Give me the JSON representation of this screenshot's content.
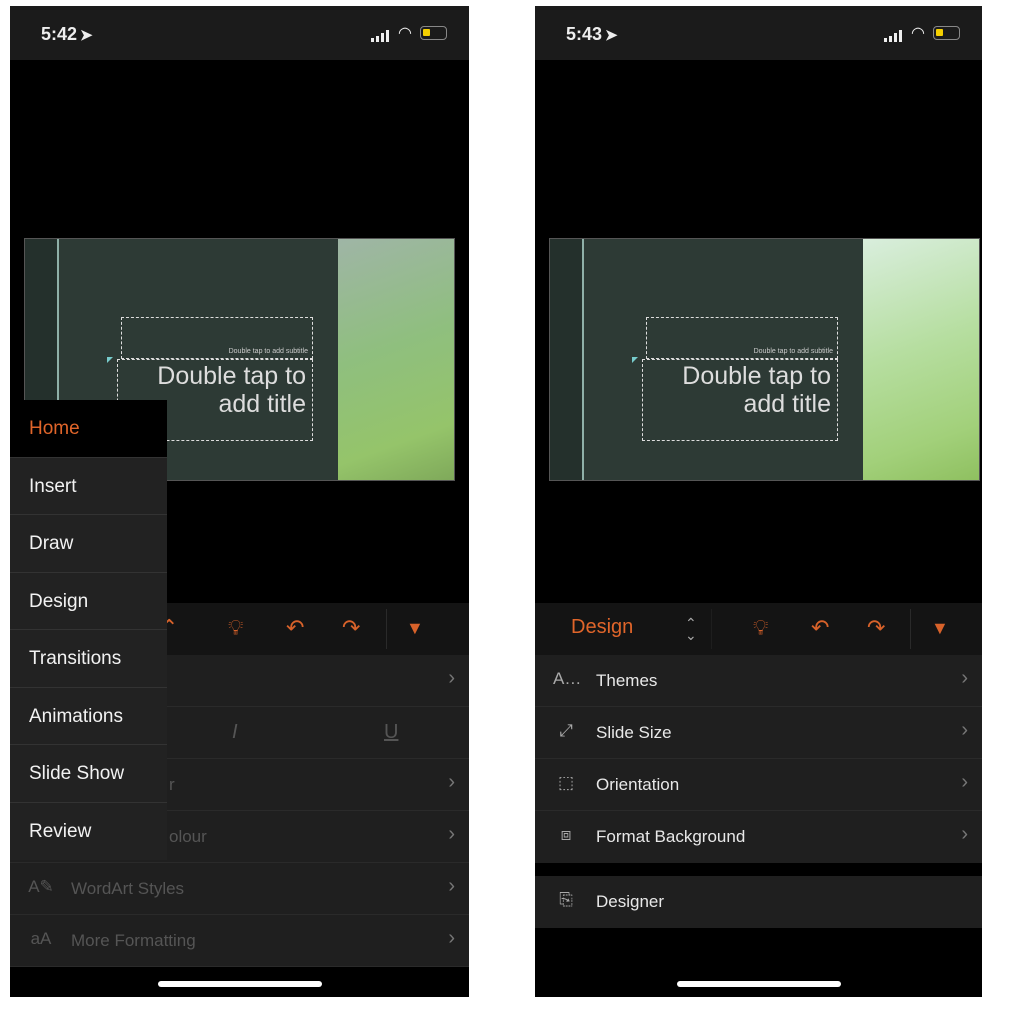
{
  "left": {
    "status": {
      "time": "5:42"
    },
    "slide": {
      "subtitle_placeholder": "Double tap to add subtitle",
      "title_placeholder": "Double tap to add title"
    },
    "tab_menu": {
      "items": [
        "Home",
        "Insert",
        "Draw",
        "Design",
        "Transitions",
        "Animations",
        "Slide Show",
        "Review"
      ],
      "active": "Home"
    },
    "list": {
      "partial_row_3": "r",
      "partial_row_4": "olour",
      "wordart": "WordArt Styles",
      "more_formatting": "More Formatting"
    },
    "format_row": {
      "italic": "I",
      "underline": "U"
    }
  },
  "right": {
    "status": {
      "time": "5:43"
    },
    "slide": {
      "subtitle_placeholder": "Double tap to add subtitle",
      "title_placeholder": "Double tap to add title"
    },
    "toolbar": {
      "tab": "Design"
    },
    "list": [
      {
        "label": "Themes",
        "icon": "themes-icon"
      },
      {
        "label": "Slide Size",
        "icon": "slide-size-icon"
      },
      {
        "label": "Orientation",
        "icon": "orientation-icon"
      },
      {
        "label": "Format Background",
        "icon": "format-background-icon"
      }
    ],
    "designer": "Designer"
  },
  "colors": {
    "accent": "#e0652a",
    "panel": "#1f1f1f",
    "toolbar": "#141414"
  }
}
